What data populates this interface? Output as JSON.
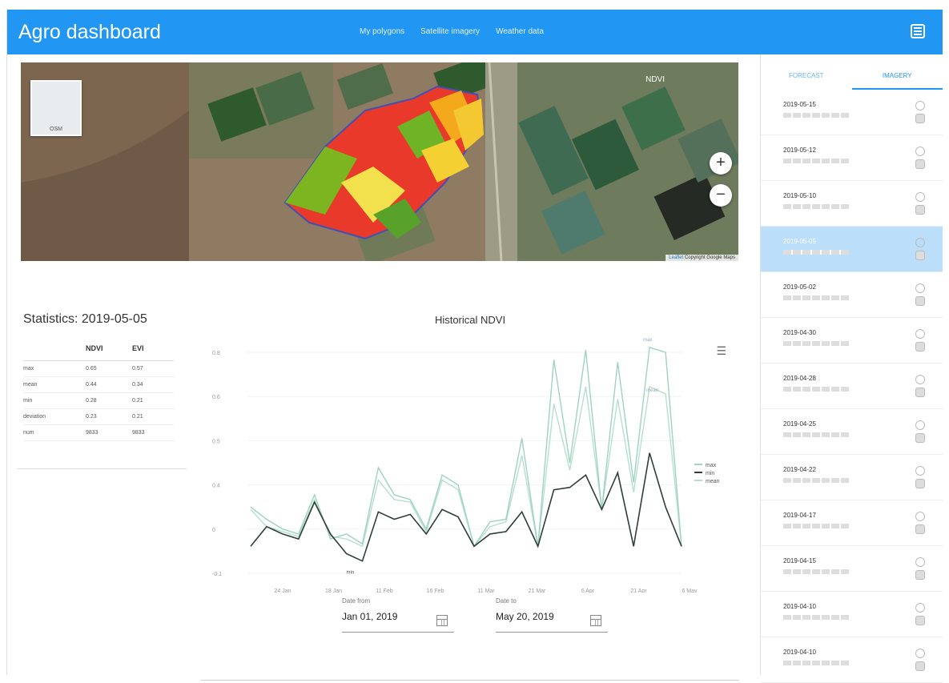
{
  "app": {
    "title": "Agro dashboard"
  },
  "nav": {
    "items": [
      "My polygons",
      "Satellite imagery",
      "Weather data"
    ]
  },
  "map": {
    "layer_label": "NDVI",
    "minimap_label": "OSM",
    "zoom_in": "+",
    "zoom_out": "−",
    "attribution_link": "Leaflet",
    "attribution_text": "Copyright Google Maps"
  },
  "stats": {
    "title": "Statistics: 2019-05-05",
    "headers": [
      "",
      "NDVI",
      "EVI"
    ],
    "rows": [
      [
        "max",
        "0.65",
        "0.57"
      ],
      [
        "mean",
        "0.44",
        "0.34"
      ],
      [
        "min",
        "0.28",
        "0.21"
      ],
      [
        "deviation",
        "0.23",
        "0.21"
      ],
      [
        "num",
        "9833",
        "9833"
      ]
    ]
  },
  "chart_data": {
    "type": "line",
    "title": "Historical NDVI",
    "ylim": [
      -0.1,
      0.8
    ],
    "yticks": [
      "0.8",
      "0.6",
      "0.5",
      "0.4",
      "0",
      "-0.1"
    ],
    "xticks": [
      "24 Jan",
      "18 Jan",
      "11 Feb",
      "16 Feb",
      "11 Mar",
      "21 Mar",
      "6 Apr",
      "21 Apr",
      "6 May"
    ],
    "legend_position": "right",
    "series": [
      {
        "name": "max",
        "color": "#9ed3bf",
        "values": [
          0.17,
          0.12,
          0.08,
          0.06,
          0.22,
          0.04,
          0.06,
          0.02,
          0.33,
          0.22,
          0.2,
          0.08,
          0.3,
          0.26,
          0.01,
          0.11,
          0.12,
          0.45,
          0.01,
          0.77,
          0.35,
          0.81,
          0.16,
          0.76,
          0.27,
          0.82,
          0.8,
          0.01
        ]
      },
      {
        "name": "min",
        "color": "#2f3e36",
        "values": [
          0.01,
          0.09,
          0.06,
          0.04,
          0.19,
          0.06,
          -0.02,
          -0.05,
          0.15,
          0.12,
          0.14,
          0.06,
          0.16,
          0.13,
          0.01,
          0.06,
          0.07,
          0.15,
          0.01,
          0.24,
          0.25,
          0.3,
          0.16,
          0.31,
          0.01,
          0.39,
          0.17,
          0.01
        ]
      },
      {
        "name": "mean",
        "color": "#b5e0cf",
        "values": [
          0.16,
          0.09,
          0.07,
          0.05,
          0.2,
          0.05,
          0.04,
          0.01,
          0.28,
          0.2,
          0.19,
          0.07,
          0.28,
          0.24,
          0.01,
          0.09,
          0.11,
          0.38,
          0.01,
          0.59,
          0.32,
          0.66,
          0.16,
          0.61,
          0.23,
          0.66,
          0.63,
          0.01
        ]
      }
    ],
    "annotations": [
      "max",
      "mean",
      "min"
    ]
  },
  "date_from": {
    "label": "Date from",
    "value": "Jan 01, 2019"
  },
  "date_to": {
    "label": "Date to",
    "value": "May 20, 2019"
  },
  "panel": {
    "tabs": [
      "FORECAST",
      "IMAGERY"
    ],
    "active_tab": "IMAGERY",
    "items": [
      {
        "date": "2019-05-15",
        "selected": false
      },
      {
        "date": "2019-05-12",
        "selected": false
      },
      {
        "date": "2019-05-10",
        "selected": false
      },
      {
        "date": "2019-05-05",
        "selected": true
      },
      {
        "date": "2019-05-02",
        "selected": false
      },
      {
        "date": "2019-04-30",
        "selected": false
      },
      {
        "date": "2019-04-28",
        "selected": false
      },
      {
        "date": "2019-04-25",
        "selected": false
      },
      {
        "date": "2019-04-22",
        "selected": false
      },
      {
        "date": "2019-04-17",
        "selected": false
      },
      {
        "date": "2019-04-15",
        "selected": false
      },
      {
        "date": "2019-04-10",
        "selected": false
      },
      {
        "date": "2019-04-10",
        "selected": false
      }
    ]
  },
  "colors": {
    "accent": "#2196f3",
    "selected_row": "#bbdefb"
  }
}
